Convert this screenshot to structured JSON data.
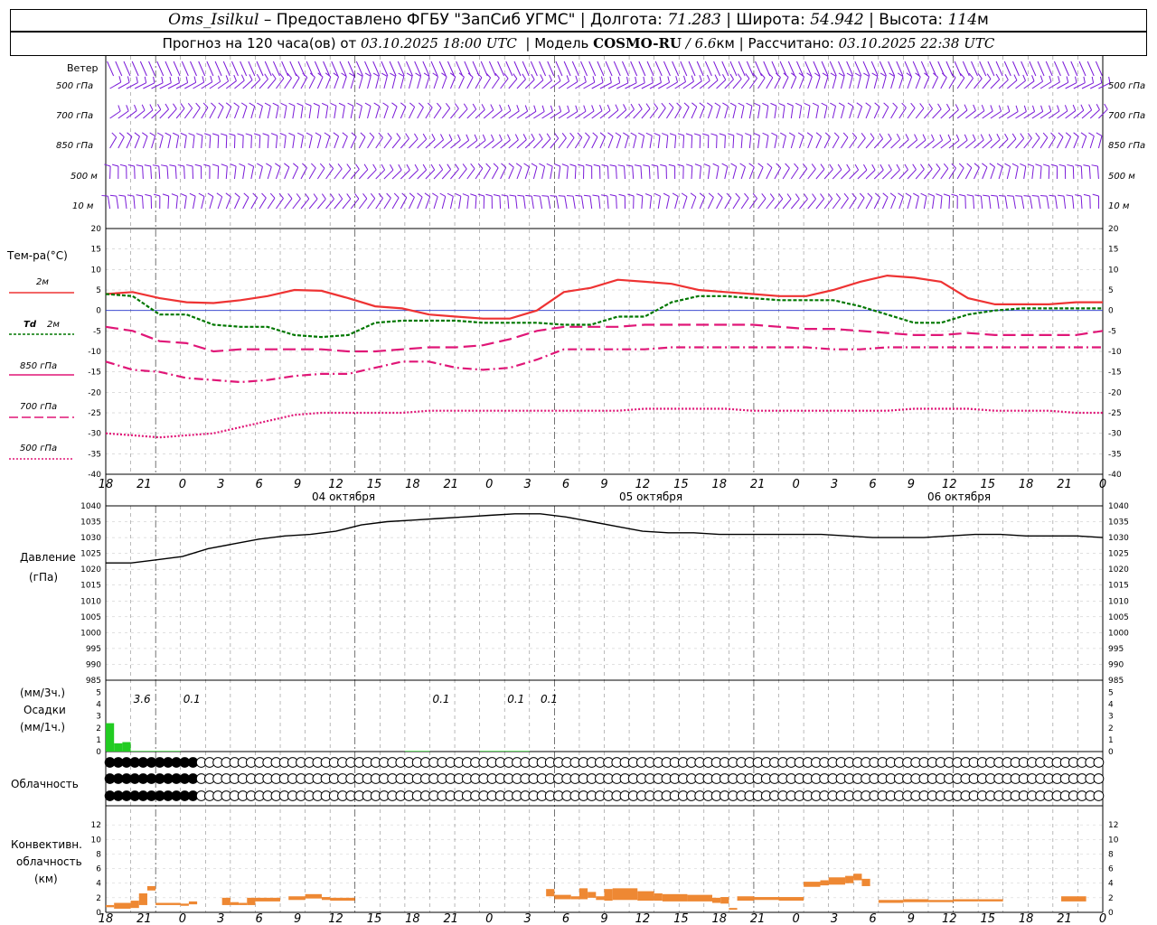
{
  "header": {
    "station": "Oms_Isilkul",
    "dash": "–",
    "provider": "Предоставлено ФГБУ \"ЗапСиб УГМС\"",
    "lon_label": "Долгота:",
    "lon_value": "71.283",
    "lat_label": "Широта:",
    "lat_value": "54.942",
    "alt_label": "Высота:",
    "alt_value": "114",
    "alt_unit": "м",
    "sep": "|"
  },
  "subheader": {
    "forecast_prefix": "Прогноз на 120 часа(ов) от",
    "run_time": "03.10.2025 18:00 UTC",
    "model_label": "Модель",
    "model_name": "COSMO-RU",
    "model_slash": "/",
    "resolution": "6.6",
    "res_unit": "км",
    "computed_label": "Рассчитано:",
    "computed_time": "03.10.2025 22:38 UTC"
  },
  "colors": {
    "t2m": "#ee3333",
    "td2m": "#007700",
    "levels": "#e01677",
    "wind": "#7a1ad8",
    "precip": "#22cc22",
    "convective": "#ee8833",
    "zero_line": "#2233cc"
  },
  "time_axis": {
    "hour_ticks": [
      "18",
      "21",
      "0",
      "3",
      "6",
      "9",
      "12",
      "15",
      "18",
      "21",
      "0",
      "3",
      "6",
      "9",
      "12",
      "15",
      "18",
      "21",
      "0",
      "3",
      "6",
      "9",
      "12",
      "15",
      "18",
      "21",
      "0"
    ],
    "dates": [
      "04 октября",
      "05 октября",
      "06 октября"
    ]
  },
  "wind_panel": {
    "rows": [
      "Ветер",
      "500 гПа",
      "700 гПа",
      "850 гПа",
      "500 м",
      "10  м"
    ],
    "right_rows": [
      "500 гПа",
      "700 гПа",
      "850 гПа",
      "500 м",
      "10  м"
    ]
  },
  "temp_panel": {
    "ylabel": "Тем-ра(°С)",
    "legend": {
      "t2m": "2м",
      "td_sym": "Td",
      "td_lvl": "2м",
      "l850": "850 гПа",
      "l700": "700 гПа",
      "l500": "500 гПа"
    },
    "ticks": [
      "20",
      "15",
      "10",
      "5",
      "0",
      "-5",
      "-10",
      "-15",
      "-20",
      "-25",
      "-30",
      "-35",
      "-40"
    ]
  },
  "pressure_panel": {
    "ylabel_1": "Давление",
    "ylabel_2": "(гПа)",
    "ticks": [
      "1040",
      "1035",
      "1030",
      "1025",
      "1020",
      "1015",
      "1010",
      "1005",
      "1000",
      "995",
      "990",
      "985"
    ]
  },
  "precip_panel": {
    "label_top": "(мм/3ч.)",
    "label_mid": "Осадки",
    "label_bot": "(мм/1ч.)",
    "ticks": [
      "5",
      "4",
      "3",
      "2",
      "1",
      "0"
    ],
    "annotations": [
      "3.6",
      "0.1",
      "0.1",
      "0.1",
      "0.1"
    ]
  },
  "cloud_panel": {
    "label": "Облачность"
  },
  "conv_panel": {
    "label_1": "Конвективн.",
    "label_2": "облачность",
    "label_3": "(км)",
    "ticks": [
      "12",
      "10",
      "8",
      "6",
      "4",
      "2",
      "0"
    ]
  },
  "chart_data": [
    {
      "type": "line",
      "title": "Тем-ра(°С)",
      "x_hours": [
        0,
        3,
        6,
        9,
        12,
        15,
        18,
        21,
        24,
        27,
        30,
        33,
        36,
        39,
        42,
        45,
        48,
        51,
        54,
        57,
        60,
        63,
        66,
        69,
        72,
        75,
        78,
        81,
        84,
        87,
        90,
        93,
        96,
        99,
        102,
        105,
        108,
        111,
        114,
        117,
        120
      ],
      "ylim": [
        -40,
        20
      ],
      "series": [
        {
          "name": "2м",
          "values": [
            4,
            4.5,
            3,
            2,
            1.8,
            2.5,
            3.5,
            5,
            4.8,
            3,
            1,
            0.5,
            -1,
            -1.5,
            -2,
            -2,
            0,
            4.5,
            5.5,
            7.5,
            7,
            6.5,
            5,
            4.5,
            4,
            3.5,
            3.5,
            5,
            7,
            8.5,
            8,
            7,
            3,
            1.5,
            1.5,
            1.5,
            2,
            2
          ]
        },
        {
          "name": "Td 2м",
          "values": [
            4,
            3.5,
            -1,
            -1,
            -3.5,
            -4,
            -4,
            -6,
            -6.5,
            -6,
            -3,
            -2.5,
            -2.5,
            -2.5,
            -3,
            -3,
            -3,
            -3.5,
            -3.5,
            -1.5,
            -1.5,
            2,
            3.5,
            3.5,
            3,
            2.5,
            2.5,
            2.5,
            1,
            -1,
            -3,
            -3,
            -1,
            0,
            0.5,
            0.5,
            0.5,
            0.5
          ]
        },
        {
          "name": "850 гПа",
          "values": [
            -4,
            -5,
            -7.5,
            -8,
            -10,
            -9.5,
            -9.5,
            -9.5,
            -9.5,
            -10,
            -10,
            -9.5,
            -9,
            -9,
            -8.5,
            -7,
            -5,
            -4,
            -4,
            -4,
            -3.5,
            -3.5,
            -3.5,
            -3.5,
            -3.5,
            -4,
            -4.5,
            -4.5,
            -5,
            -5.5,
            -6,
            -6,
            -5.5,
            -6,
            -6,
            -6,
            -6,
            -5
          ]
        },
        {
          "name": "700 гПа",
          "values": [
            -12.5,
            -14.5,
            -15,
            -16.5,
            -17,
            -17.5,
            -17,
            -16,
            -15.5,
            -15.5,
            -14,
            -12.5,
            -12.5,
            -14,
            -14.5,
            -14,
            -12,
            -9.5,
            -9.5,
            -9.5,
            -9.5,
            -9,
            -9,
            -9,
            -9,
            -9,
            -9,
            -9.5,
            -9.5,
            -9,
            -9,
            -9,
            -9,
            -9,
            -9,
            -9,
            -9,
            -9
          ]
        },
        {
          "name": "500 гПа",
          "values": [
            -30,
            -30.5,
            -31,
            -30.5,
            -30,
            -28.5,
            -27,
            -25.5,
            -25,
            -25,
            -25,
            -25,
            -24.5,
            -24.5,
            -24.5,
            -24.5,
            -24.5,
            -24.5,
            -24.5,
            -24.5,
            -24,
            -24,
            -24,
            -24,
            -24.5,
            -24.5,
            -24.5,
            -24.5,
            -24.5,
            -24.5,
            -24,
            -24,
            -24,
            -24.5,
            -24.5,
            -24.5,
            -25,
            -25
          ]
        }
      ]
    },
    {
      "type": "line",
      "title": "Давление (гПа)",
      "x_hours": [
        0,
        3,
        6,
        9,
        12,
        15,
        18,
        21,
        24,
        27,
        30,
        33,
        36,
        39,
        42,
        45,
        48,
        51,
        54,
        57,
        60,
        63,
        66,
        69,
        72,
        75,
        78,
        81,
        84,
        87,
        90,
        93,
        96,
        99,
        102,
        105,
        108,
        111,
        114,
        117,
        120
      ],
      "ylim": [
        985,
        1040
      ],
      "values": [
        1022,
        1022,
        1023,
        1024,
        1026.5,
        1028,
        1029.5,
        1030.5,
        1031,
        1032,
        1034,
        1035,
        1035.5,
        1036,
        1036.5,
        1037,
        1037.5,
        1037.5,
        1036.5,
        1035,
        1033.5,
        1032,
        1031.5,
        1031.5,
        1031,
        1031,
        1031,
        1031,
        1031,
        1030.5,
        1030,
        1030,
        1030,
        1030.5,
        1031,
        1031,
        1030.5,
        1030.5,
        1030.5,
        1030
      ]
    },
    {
      "type": "bar",
      "title": "Осадки",
      "ylim": [
        0,
        5
      ],
      "hourly_bars": [
        {
          "start_h": 0,
          "end_h": 1,
          "value": 2.4
        },
        {
          "start_h": 1,
          "end_h": 2,
          "value": 0.7
        },
        {
          "start_h": 2,
          "end_h": 3,
          "value": 0.8
        },
        {
          "start_h": 3,
          "end_h": 6,
          "value": 0.05
        },
        {
          "start_h": 6,
          "end_h": 9,
          "value": 0.05
        },
        {
          "start_h": 36,
          "end_h": 39,
          "value": 0.05
        },
        {
          "start_h": 45,
          "end_h": 48,
          "value": 0.05
        },
        {
          "start_h": 48,
          "end_h": 51,
          "value": 0.05
        }
      ],
      "annotation_hours": [
        3,
        9,
        39,
        48,
        52
      ]
    },
    {
      "type": "table",
      "title": "Облачность",
      "rows": [
        "FFFFFFFFFFFEEEEEEEEEEEEEEEEEEEEEEEEEEEEEEEEEEEEEEEEEEEEEEEEEEEEEEEEEEEEEEEEEEEEEEEEEEEEEEEEEEEEEEEEEEEEEEEEEEEEEEEEEEEE",
        "FFFFFFFFFFFEEEEEEEEEEEEEEEEEEEEEEEEEEEEEEEEEEEEEEEEEEEEEEEEEEEEEEEEEEEEEEEEEEEEEEEEEEEEEEEEEEEEEEEEEEEEEEEEEEEEEEEEEEEEE",
        "FFFFFFFFFFFEEEEEEEEEEEEEEEEEEEEEEEEEEEEEEEEEEEEEEEEEEEEEEEEEEEEEEEEEEEEEEEEEEEEEEEEEEEEEEEEEEEEEEEEEEEEEEEEEEEEEEEEEEEEE"
      ],
      "note": "E=clear,F=overcast (per-hour cells, 3 layers)"
    },
    {
      "type": "bar",
      "title": "Конвективн. облачность (км)",
      "ylim": [
        0,
        13
      ],
      "segments": [
        {
          "start_h": 0,
          "end_h": 1,
          "base": 0.7,
          "top": 1.0
        },
        {
          "start_h": 1,
          "end_h": 3,
          "base": 0.5,
          "top": 1.3
        },
        {
          "start_h": 3,
          "end_h": 4,
          "base": 0.6,
          "top": 1.6
        },
        {
          "start_h": 4,
          "end_h": 5,
          "base": 1.0,
          "top": 2.6
        },
        {
          "start_h": 5,
          "end_h": 6,
          "base": 3.0,
          "top": 3.6
        },
        {
          "start_h": 6,
          "end_h": 9,
          "base": 1.0,
          "top": 1.3
        },
        {
          "start_h": 9,
          "end_h": 10,
          "base": 0.9,
          "top": 1.2
        },
        {
          "start_h": 10,
          "end_h": 11,
          "base": 1.1,
          "top": 1.5
        },
        {
          "start_h": 14,
          "end_h": 15,
          "base": 1.0,
          "top": 2.0
        },
        {
          "start_h": 15,
          "end_h": 16,
          "base": 1.0,
          "top": 1.4
        },
        {
          "start_h": 16,
          "end_h": 17,
          "base": 1.0,
          "top": 1.3
        },
        {
          "start_h": 17,
          "end_h": 18,
          "base": 1.0,
          "top": 2.0
        },
        {
          "start_h": 18,
          "end_h": 21,
          "base": 1.5,
          "top": 2.0
        },
        {
          "start_h": 22,
          "end_h": 24,
          "base": 1.7,
          "top": 2.2
        },
        {
          "start_h": 24,
          "end_h": 26,
          "base": 1.9,
          "top": 2.5
        },
        {
          "start_h": 26,
          "end_h": 27,
          "base": 1.7,
          "top": 2.1
        },
        {
          "start_h": 27,
          "end_h": 30,
          "base": 1.6,
          "top": 2.0
        },
        {
          "start_h": 53,
          "end_h": 54,
          "base": 2.2,
          "top": 3.2
        },
        {
          "start_h": 54,
          "end_h": 56,
          "base": 1.8,
          "top": 2.4
        },
        {
          "start_h": 56,
          "end_h": 57,
          "base": 1.8,
          "top": 2.2
        },
        {
          "start_h": 57,
          "end_h": 58,
          "base": 1.8,
          "top": 3.3
        },
        {
          "start_h": 58,
          "end_h": 59,
          "base": 2.0,
          "top": 2.8
        },
        {
          "start_h": 59,
          "end_h": 60,
          "base": 1.7,
          "top": 2.2
        },
        {
          "start_h": 60,
          "end_h": 61,
          "base": 1.6,
          "top": 3.2
        },
        {
          "start_h": 61,
          "end_h": 64,
          "base": 1.7,
          "top": 3.3
        },
        {
          "start_h": 64,
          "end_h": 66,
          "base": 1.6,
          "top": 2.9
        },
        {
          "start_h": 66,
          "end_h": 67,
          "base": 1.6,
          "top": 2.6
        },
        {
          "start_h": 67,
          "end_h": 70,
          "base": 1.5,
          "top": 2.5
        },
        {
          "start_h": 70,
          "end_h": 73,
          "base": 1.5,
          "top": 2.4
        },
        {
          "start_h": 73,
          "end_h": 74,
          "base": 1.3,
          "top": 2.0
        },
        {
          "start_h": 74,
          "end_h": 75,
          "base": 1.2,
          "top": 2.1
        },
        {
          "start_h": 75,
          "end_h": 76,
          "base": 0.4,
          "top": 0.6
        },
        {
          "start_h": 76,
          "end_h": 78,
          "base": 1.6,
          "top": 2.2
        },
        {
          "start_h": 78,
          "end_h": 81,
          "base": 1.7,
          "top": 2.1
        },
        {
          "start_h": 81,
          "end_h": 84,
          "base": 1.6,
          "top": 2.1
        },
        {
          "start_h": 84,
          "end_h": 86,
          "base": 3.5,
          "top": 4.2
        },
        {
          "start_h": 86,
          "end_h": 87,
          "base": 3.7,
          "top": 4.4
        },
        {
          "start_h": 87,
          "end_h": 89,
          "base": 3.8,
          "top": 4.8
        },
        {
          "start_h": 89,
          "end_h": 90,
          "base": 4.0,
          "top": 5.0
        },
        {
          "start_h": 90,
          "end_h": 91,
          "base": 4.4,
          "top": 5.3
        },
        {
          "start_h": 91,
          "end_h": 92,
          "base": 3.6,
          "top": 4.6
        },
        {
          "start_h": 93,
          "end_h": 96,
          "base": 1.3,
          "top": 1.7
        },
        {
          "start_h": 96,
          "end_h": 99,
          "base": 1.4,
          "top": 1.8
        },
        {
          "start_h": 99,
          "end_h": 102,
          "base": 1.4,
          "top": 1.7
        },
        {
          "start_h": 102,
          "end_h": 105,
          "base": 1.5,
          "top": 1.8
        },
        {
          "start_h": 105,
          "end_h": 108,
          "base": 1.5,
          "top": 1.8
        },
        {
          "start_h": 115,
          "end_h": 118,
          "base": 1.5,
          "top": 2.2
        }
      ]
    }
  ]
}
